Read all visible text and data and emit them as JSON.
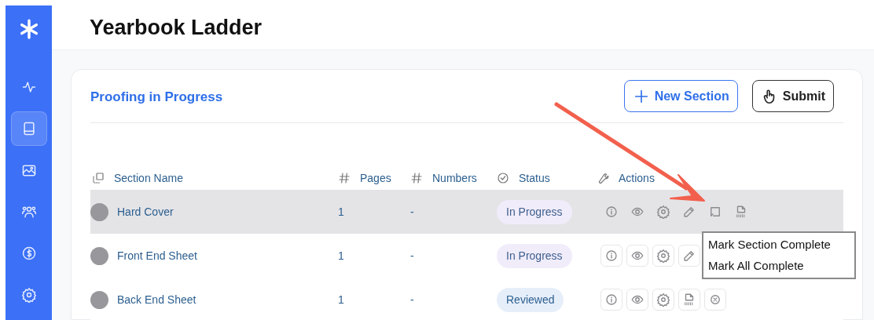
{
  "sidebar": {
    "items": [
      {
        "kind": "activity",
        "selected": false
      },
      {
        "kind": "book",
        "selected": true
      },
      {
        "kind": "photos",
        "selected": false
      },
      {
        "kind": "people",
        "selected": false
      },
      {
        "kind": "money",
        "selected": false
      },
      {
        "kind": "settings",
        "selected": false
      }
    ]
  },
  "page_title": "Yearbook Ladder",
  "card": {
    "title": "Proofing in Progress",
    "buttons": [
      {
        "kind": "new",
        "label": "New Section"
      },
      {
        "kind": "submit",
        "label": "Submit"
      }
    ]
  },
  "table": {
    "columns": [
      {
        "kind": "name",
        "label": "Section Name"
      },
      {
        "kind": "hash",
        "label": "Pages"
      },
      {
        "kind": "hash",
        "label": "Numbers"
      },
      {
        "kind": "status",
        "label": "Status"
      },
      {
        "kind": "actions",
        "label": "Actions"
      }
    ],
    "rows": [
      {
        "name": "Hard Cover",
        "pages": "1",
        "numbers": "-",
        "status": {
          "kind": "in_progress",
          "label": "In Progress"
        },
        "highlighted": true,
        "actions": [
          {
            "kind": "info"
          },
          {
            "kind": "view"
          },
          {
            "kind": "settings"
          },
          {
            "kind": "edit"
          },
          {
            "kind": "complete"
          },
          {
            "kind": "pdf"
          }
        ]
      },
      {
        "name": "Front End Sheet",
        "pages": "1",
        "numbers": "-",
        "status": {
          "kind": "in_progress",
          "label": "In Progress"
        },
        "highlighted": false,
        "actions": [
          {
            "kind": "info"
          },
          {
            "kind": "view"
          },
          {
            "kind": "settings"
          },
          {
            "kind": "edit"
          }
        ]
      },
      {
        "name": "Back End Sheet",
        "pages": "1",
        "numbers": "-",
        "status": {
          "kind": "reviewed",
          "label": "Reviewed"
        },
        "highlighted": false,
        "actions": [
          {
            "kind": "info"
          },
          {
            "kind": "view"
          },
          {
            "kind": "settings"
          },
          {
            "kind": "pdf"
          },
          {
            "kind": "cancel"
          }
        ]
      }
    ]
  },
  "menu": {
    "items": [
      "Mark Section Complete",
      "Mark All Complete"
    ]
  }
}
